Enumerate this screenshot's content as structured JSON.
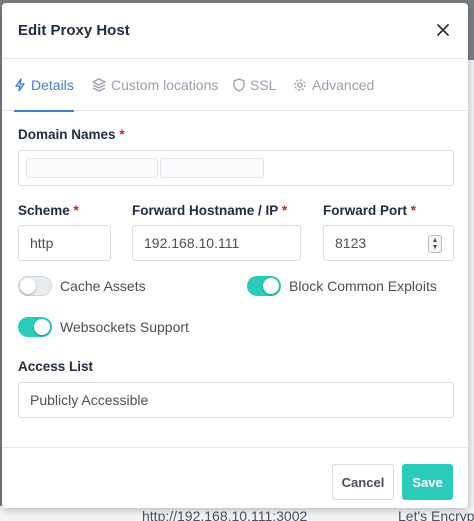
{
  "background": {
    "row_values": [
      "http://192.168.10.111:3002",
      "Let's Encrypt"
    ]
  },
  "modal": {
    "title": "Edit Proxy Host",
    "close_icon": "close-icon",
    "tabs": [
      {
        "label": "Details",
        "icon": "lightning-icon",
        "active": true
      },
      {
        "label": "Custom locations",
        "icon": "layers-icon",
        "active": false
      },
      {
        "label": "SSL",
        "icon": "shield-icon",
        "active": false
      },
      {
        "label": "Advanced",
        "icon": "gear-icon",
        "active": false
      }
    ],
    "domain_names": {
      "label": "Domain Names",
      "required_mark": "*"
    },
    "scheme": {
      "label": "Scheme",
      "required_mark": "*",
      "value": "http"
    },
    "forward_host": {
      "label": "Forward Hostname / IP",
      "required_mark": "*",
      "value": "192.168.10.111"
    },
    "forward_port": {
      "label": "Forward Port",
      "required_mark": "*",
      "value": "8123"
    },
    "toggles": {
      "cache_assets": {
        "label": "Cache Assets",
        "on": false
      },
      "block_exploits": {
        "label": "Block Common Exploits",
        "on": true
      },
      "websockets": {
        "label": "Websockets Support",
        "on": true
      }
    },
    "access_list": {
      "label": "Access List",
      "value": "Publicly Accessible"
    },
    "footer": {
      "cancel_label": "Cancel",
      "save_label": "Save"
    }
  },
  "colors": {
    "accent": "#467fcf",
    "toggle_on": "#2bcbba",
    "required": "#cd201f",
    "save_button": "#2bcbba"
  }
}
